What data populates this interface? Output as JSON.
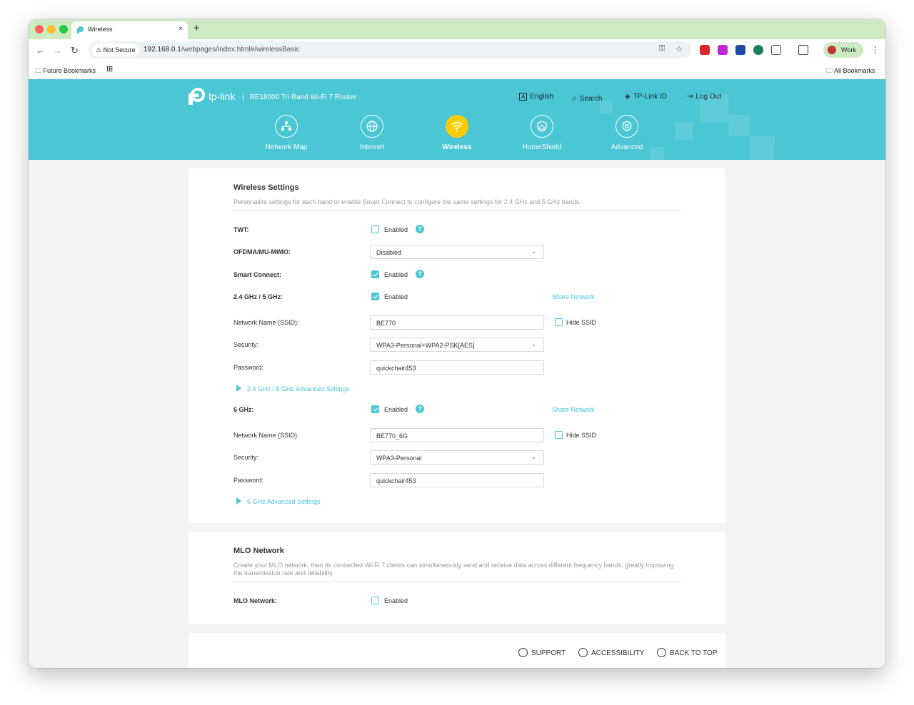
{
  "browser": {
    "tab_title": "Wireless",
    "tab_close": "×",
    "new_tab": "+",
    "not_secure": "Not Secure",
    "url_host": "192.168.0.1",
    "url_path": "/webpages/index.html#/wirelessBasic",
    "profile_name": "Work",
    "bookmark_left": "Future Bookmarks",
    "bookmark_right": "All Bookmarks",
    "accent": "#cdeac3"
  },
  "router": {
    "brand": "tp-link",
    "model": "BE18000 Tri-Band Wi-Fi 7 Router",
    "header_links": {
      "language": "English",
      "search": "Search",
      "tplink_id": "TP-Link ID",
      "logout": "Log Out"
    },
    "nav": [
      {
        "label": "Network Map",
        "icon": "network-map-icon"
      },
      {
        "label": "Internet",
        "icon": "globe-icon"
      },
      {
        "label": "Wireless",
        "icon": "wifi-icon",
        "active": true
      },
      {
        "label": "HomeShield",
        "icon": "home-shield-icon"
      },
      {
        "label": "Advanced",
        "icon": "gear-icon"
      }
    ],
    "accent": "#4bc6d4",
    "active_color": "#ffcc00"
  },
  "wireless": {
    "title": "Wireless Settings",
    "description": "Personalize settings for each band or enable Smart Connect to configure the same settings for 2.4 GHz and 5 GHz bands.",
    "twt_label": "TWT:",
    "twt_enabled": "Enabled",
    "ofdma_label": "OFDMA/MU-MIMO:",
    "ofdma_value": "Disabled",
    "smart_label": "Smart Connect:",
    "smart_enabled": "Enabled",
    "band24_label": "2.4 GHz / 5 GHz:",
    "band24_enabled": "Enabled",
    "share_network": "Share Network",
    "ssid_label": "Network Name (SSID):",
    "ssid24_value": "BE770",
    "hide_ssid": "Hide SSID",
    "security_label": "Security:",
    "security24_value": "WPA3-Personal+WPA2-PSK[AES]",
    "password_label": "Password:",
    "password24_value": "quickchair453",
    "advanced24": "2.4 GHz / 5 GHz Advanced Settings",
    "band6_label": "6 GHz:",
    "band6_enabled": "Enabled",
    "ssid6_value": "BE770_6G",
    "security6_value": "WPA3-Personal",
    "password6_value": "quickchair453",
    "advanced6": "6 GHz Advanced Settings"
  },
  "mlo": {
    "title": "MLO Network",
    "description": "Create your MLO network, then its connected Wi-Fi 7 clients can simultaneously send and receive data across different frequency bands, greatly improving the transmission rate and reliability.",
    "label": "MLO Network:",
    "enabled": "Enabled"
  },
  "footer": {
    "support": "SUPPORT",
    "accessibility": "ACCESSIBILITY",
    "back_to_top": "BACK TO TOP"
  }
}
